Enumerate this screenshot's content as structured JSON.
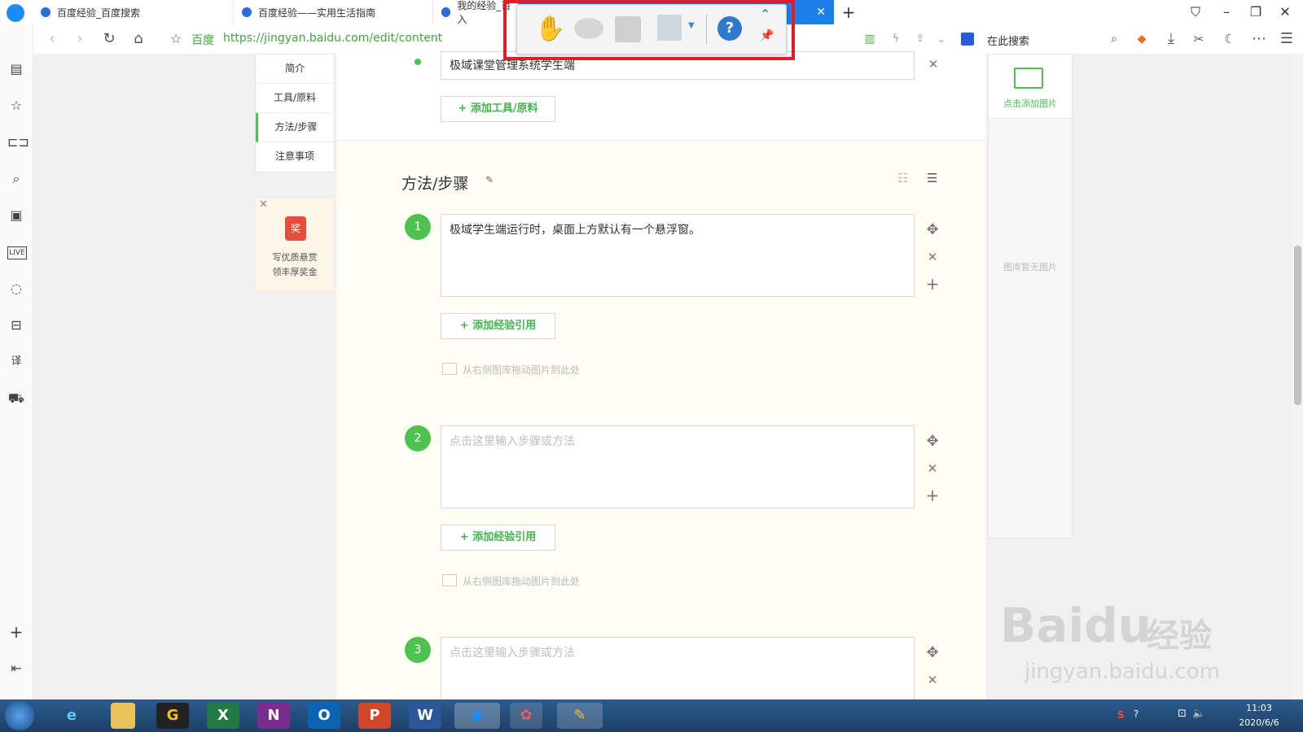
{
  "tabs": [
    {
      "title": "百度经验_百度搜索"
    },
    {
      "title": "百度经验——实用生活指南"
    },
    {
      "title": "我的经验_百入"
    },
    {
      "title": ""
    }
  ],
  "address": {
    "site_label": "百度",
    "url": "https://jingyan.baidu.com/edit/content",
    "search_placeholder": "在此搜索"
  },
  "page_nav": [
    {
      "label": "简介"
    },
    {
      "label": "工具/原料"
    },
    {
      "label": "方法/步骤"
    },
    {
      "label": "注意事项"
    }
  ],
  "reward": {
    "badge": "奖",
    "line1": "写优质悬赏",
    "line2": "领丰厚奖金"
  },
  "tools": {
    "item_value": "极域课堂管理系统学生端",
    "add_button": "+ 添加工具/原料"
  },
  "section": {
    "title": "方法/步骤"
  },
  "steps": [
    {
      "number": "1",
      "text": "极域学生端运行时，桌面上方默认有一个悬浮窗。",
      "placeholder": "",
      "add_ref": "+ 添加经验引用",
      "drag_hint": "从右侧图库拖动图片到此处"
    },
    {
      "number": "2",
      "text": "",
      "placeholder": "点击这里输入步骤或方法",
      "add_ref": "+ 添加经验引用",
      "drag_hint": "从右侧图库拖动图片到此处"
    },
    {
      "number": "3",
      "text": "",
      "placeholder": "点击这里输入步骤或方法",
      "add_ref": "",
      "drag_hint": ""
    }
  ],
  "gallery": {
    "add_label": "点击添加图片",
    "empty": "图库暂无图片"
  },
  "watermark": {
    "brand": "Baidu",
    "suffix": "经验",
    "url": "jingyan.baidu.com"
  },
  "clock": {
    "time": "11:03",
    "date": "2020/6/6"
  },
  "colors": {
    "accent_green": "#4ec24e",
    "highlight_red": "#e21b24",
    "tab_active": "#1a7fe8"
  }
}
